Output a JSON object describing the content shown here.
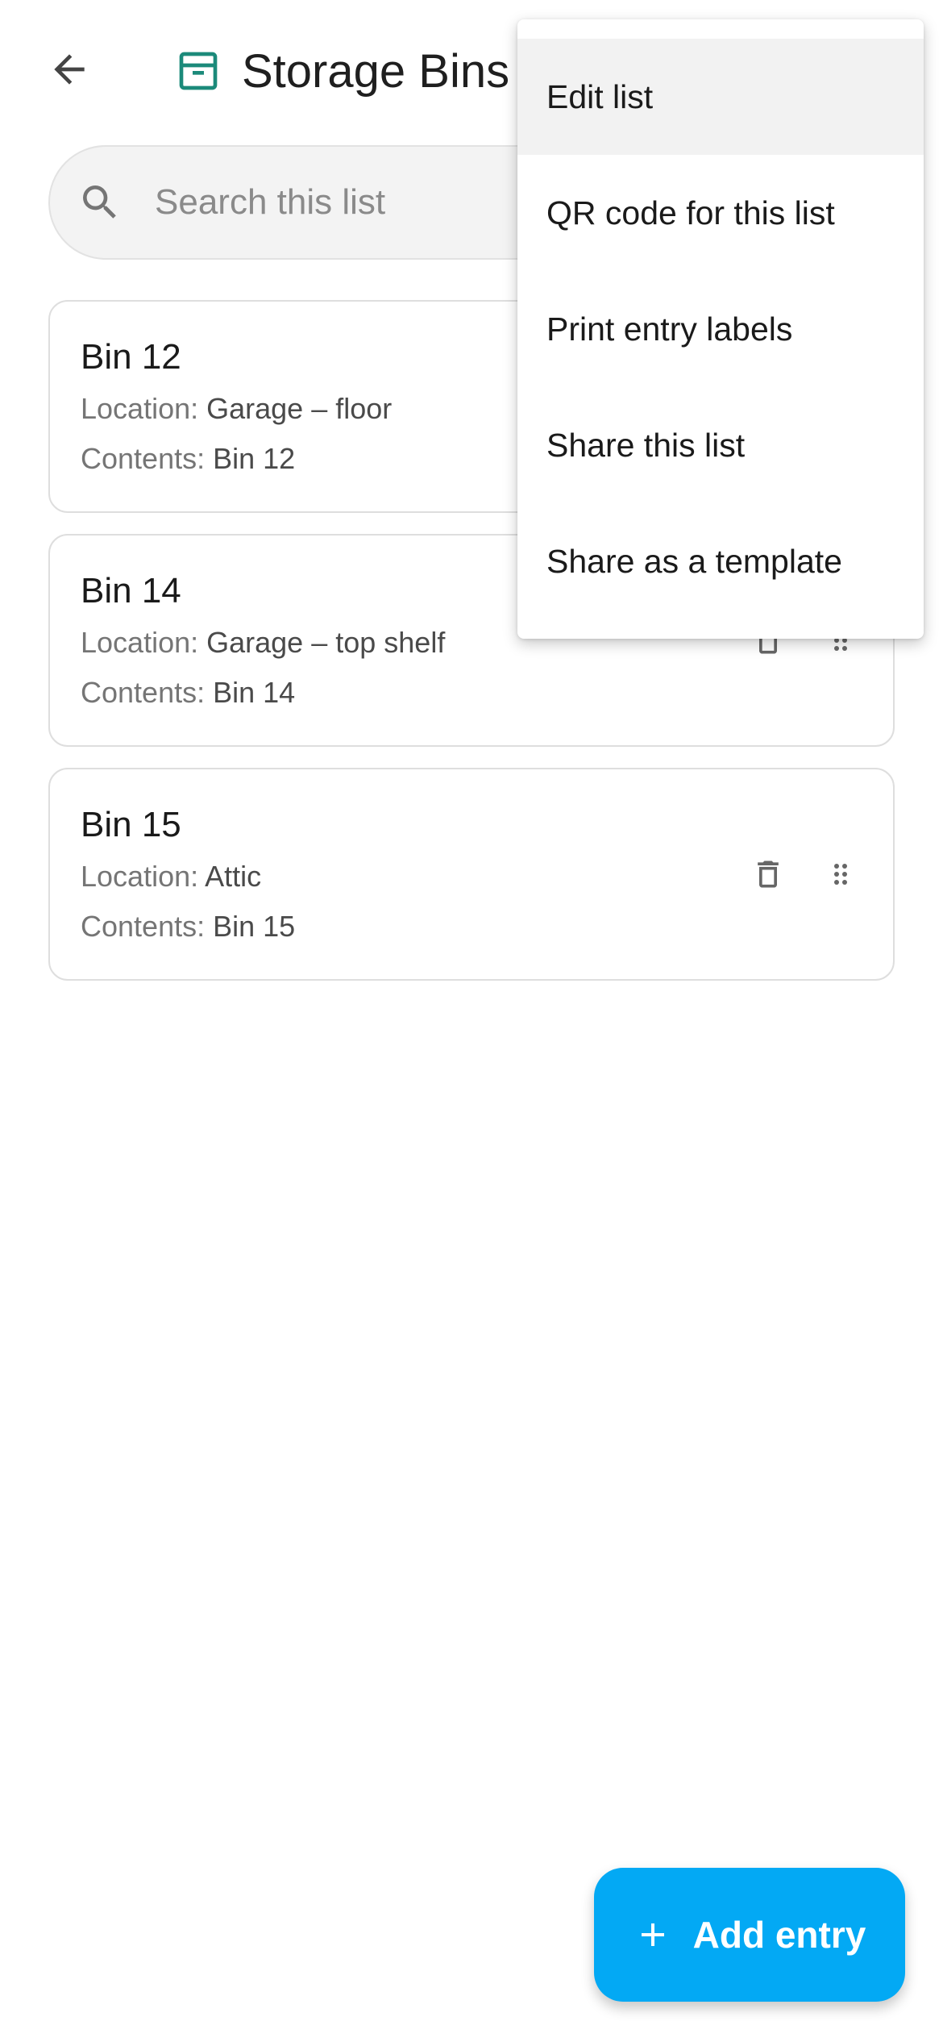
{
  "header": {
    "title": "Storage Bins",
    "back_icon": "arrow-back-icon",
    "list_icon": "archive-box-icon"
  },
  "colors": {
    "accent": "#03a9f4",
    "title_icon": "#1b8a7a"
  },
  "search": {
    "placeholder": "Search this list",
    "value": ""
  },
  "entries": [
    {
      "name": "Bin 12",
      "location_label": "Location:",
      "location": "Garage – floor",
      "contents_label": "Contents:",
      "contents": "Bin 12"
    },
    {
      "name": "Bin 14",
      "location_label": "Location:",
      "location": "Garage – top shelf",
      "contents_label": "Contents:",
      "contents": "Bin 14"
    },
    {
      "name": "Bin 15",
      "location_label": "Location:",
      "location": "Attic",
      "contents_label": "Contents:",
      "contents": "Bin 15"
    }
  ],
  "menu": {
    "items": [
      {
        "label": "Edit list"
      },
      {
        "label": "QR code for this list"
      },
      {
        "label": "Print entry labels"
      },
      {
        "label": "Share this list"
      },
      {
        "label": "Share as a template"
      }
    ]
  },
  "fab": {
    "label": "Add entry",
    "icon": "plus-icon"
  }
}
